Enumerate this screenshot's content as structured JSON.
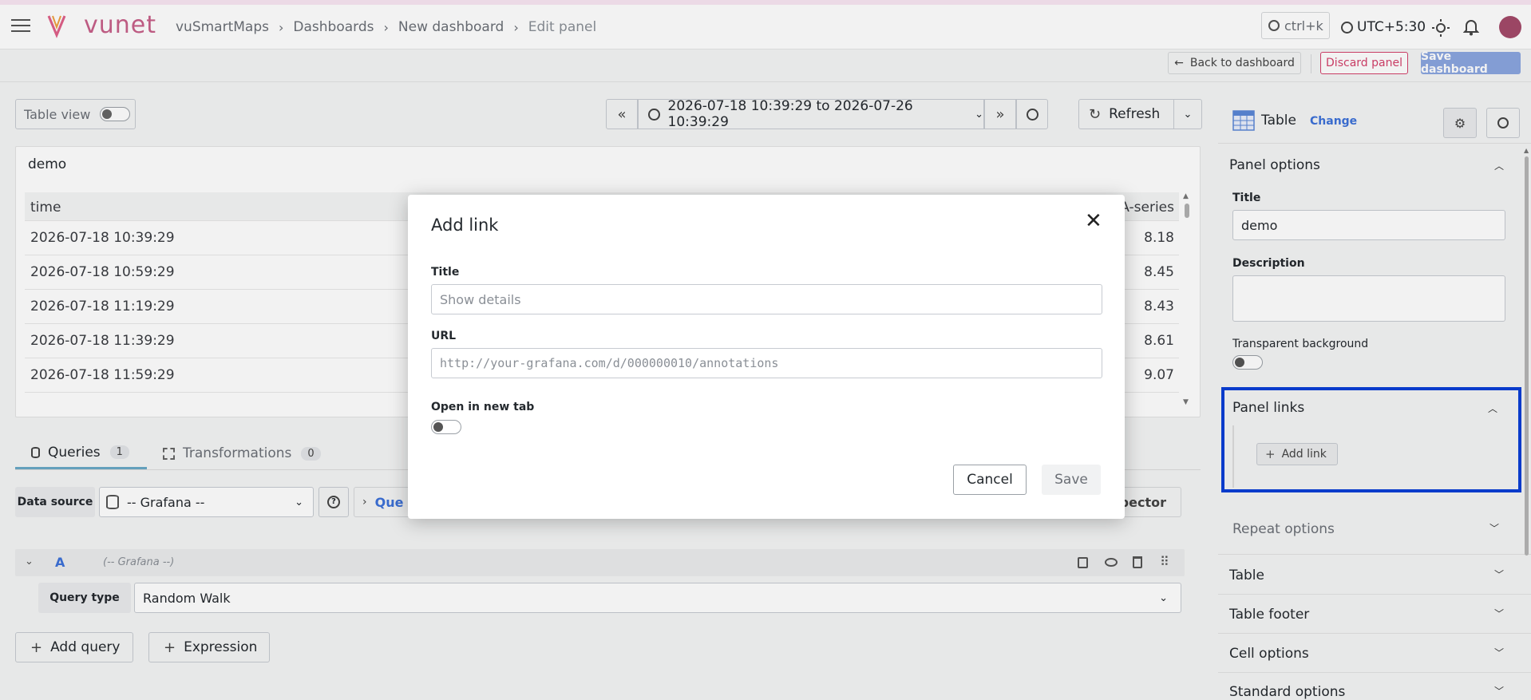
{
  "topbar": {
    "brand": "vunet",
    "breadcrumbs": [
      "vuSmartMaps",
      "Dashboards",
      "New dashboard",
      "Edit panel"
    ],
    "search_placeholder": "ctrl+k",
    "timezone": "UTC+5:30"
  },
  "toolbar": {
    "back_label": "Back to dashboard",
    "discard_label": "Discard panel",
    "save_label": "Save dashboard"
  },
  "editor": {
    "table_view_label": "Table view",
    "time_range": "2026-07-18 10:39:29 to 2026-07-26 10:39:29",
    "refresh_label": "Refresh",
    "panel_title": "demo",
    "columns": [
      "time",
      "A-series"
    ],
    "rows": [
      {
        "time": "2026-07-18 10:39:29",
        "value": "8.18"
      },
      {
        "time": "2026-07-18 10:59:29",
        "value": "8.45"
      },
      {
        "time": "2026-07-18 11:19:29",
        "value": "8.43"
      },
      {
        "time": "2026-07-18 11:39:29",
        "value": "8.61"
      },
      {
        "time": "2026-07-18 11:59:29",
        "value": "9.07"
      }
    ],
    "tabs": [
      {
        "label": "Queries",
        "count": "1"
      },
      {
        "label": "Transformations",
        "count": "0"
      }
    ],
    "datasource_label": "Data source",
    "datasource_value": "-- Grafana --",
    "query_options_partial": "Que",
    "inspector_partial": "pector",
    "query": {
      "ref": "A",
      "source": "(-- Grafana --)",
      "type_label": "Query type",
      "type_value": "Random Walk"
    },
    "add_query_label": "Add query",
    "expression_label": "Expression"
  },
  "modal": {
    "title": "Add link",
    "title_field_label": "Title",
    "title_placeholder": "Show details",
    "url_label": "URL",
    "url_placeholder": "http://your-grafana.com/d/000000010/annotations",
    "new_tab_label": "Open in new tab",
    "new_tab_on": false,
    "cancel_label": "Cancel",
    "save_label": "Save"
  },
  "options_pane": {
    "viz_name": "Table",
    "change_label": "Change",
    "sections": {
      "panel_options": "Panel options",
      "title_label": "Title",
      "title_value": "demo",
      "description_label": "Description",
      "transparent_label": "Transparent background",
      "panel_links": "Panel links",
      "add_link_label": "Add link",
      "repeat": "Repeat options",
      "table": "Table",
      "table_footer": "Table footer",
      "cell_options": "Cell options",
      "standard_options": "Standard options"
    },
    "highlight_color": "#0a3fd6"
  }
}
